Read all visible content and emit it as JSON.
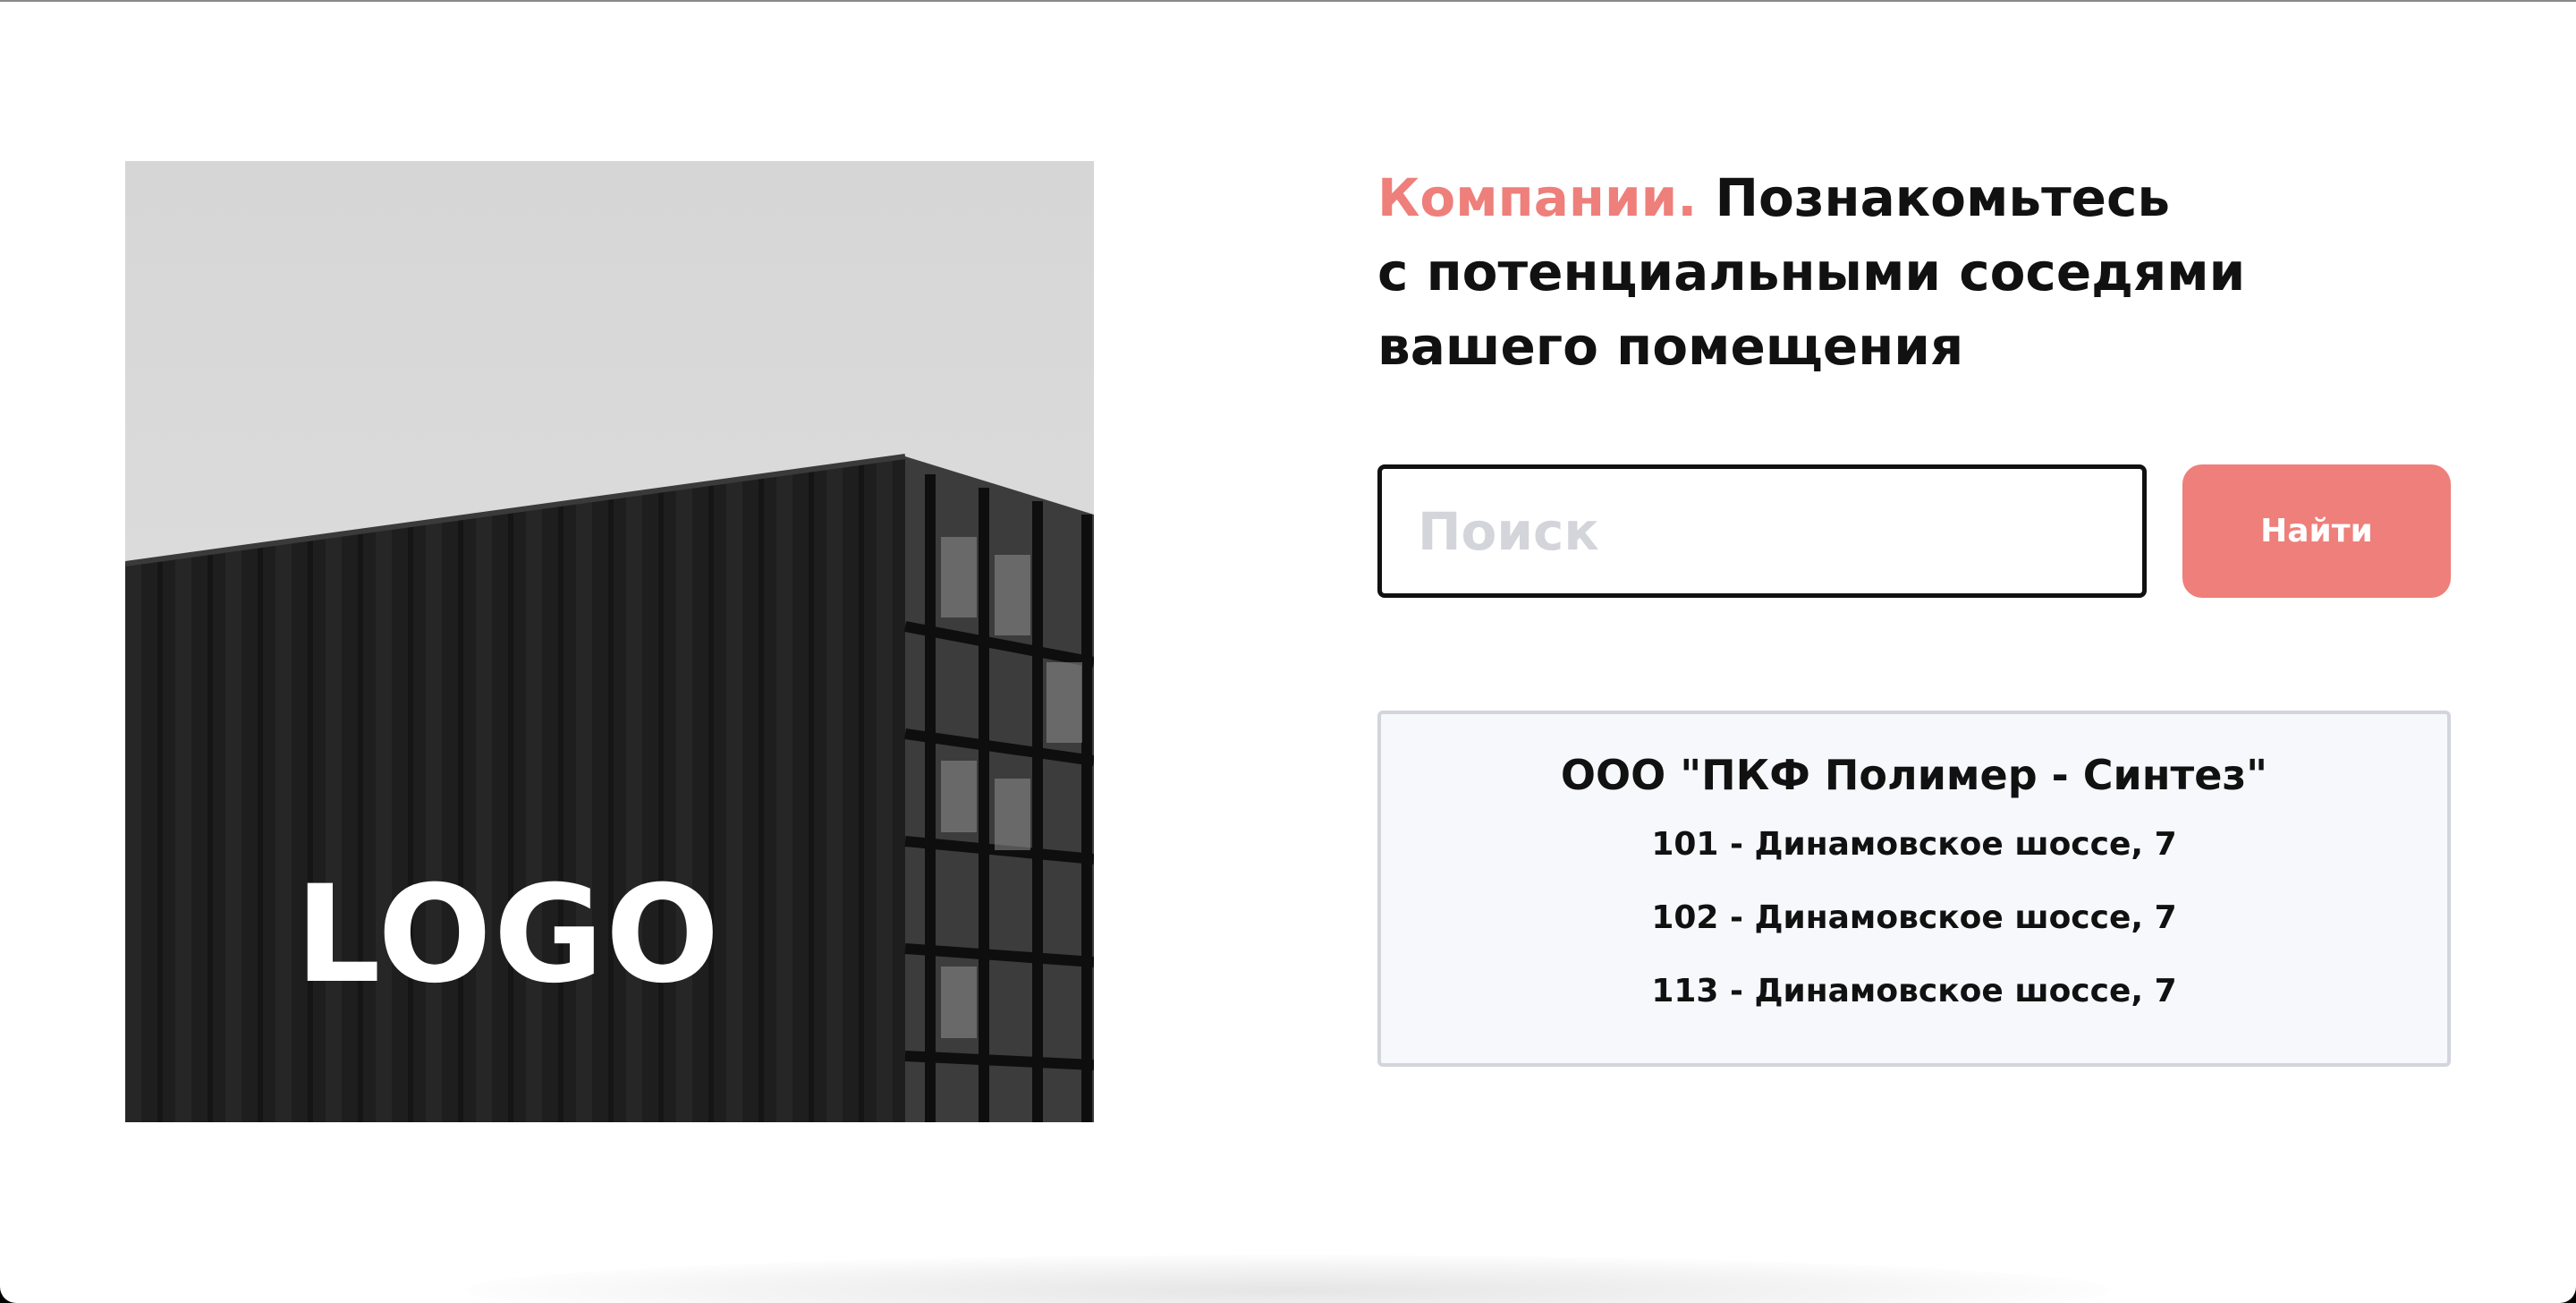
{
  "hero": {
    "logo_text": "LOGO"
  },
  "headline": {
    "accent": "Компании.",
    "line1_rest": "Познакомьтесь",
    "line2": "с потенциальными соседями",
    "line3": "вашего помещения"
  },
  "search": {
    "placeholder": "Поиск",
    "value": "",
    "button_label": "Найти"
  },
  "result": {
    "company_name": "ООО \"ПКФ Полимер - Синтез\"",
    "addresses": [
      "101 - Динамовское шоссе, 7",
      "102 - Динамовское шоссе, 7",
      "113 - Динамовское шоссе, 7"
    ]
  },
  "colors": {
    "accent": "#ee7f7a",
    "text": "#111111",
    "card_background": "#f6f8fc",
    "card_border": "#d2d5dc",
    "placeholder": "#d3d5db"
  }
}
